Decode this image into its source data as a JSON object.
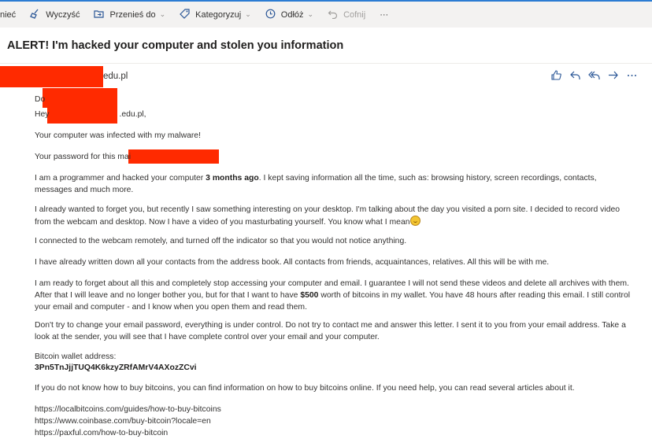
{
  "toolbar": {
    "items": [
      {
        "label": "nieć"
      },
      {
        "label": "Wyczyść",
        "icon": "broom-icon"
      },
      {
        "label": "Przenieś do",
        "icon": "move-folder-icon"
      },
      {
        "label": "Kategoryzuj",
        "icon": "tag-icon"
      },
      {
        "label": "Odłóż",
        "icon": "clock-icon"
      },
      {
        "label": "Cofnij",
        "icon": "undo-icon"
      },
      {
        "label": "···",
        "icon": "more-icon"
      }
    ]
  },
  "email": {
    "subject": "ALERT! I'm hacked your computer and stolen you information",
    "sender_suffix": "edu.pl",
    "actions": [
      "like-icon",
      "reply-icon",
      "reply-all-icon",
      "forward-icon",
      "more-icon"
    ],
    "body": {
      "greeting_do": "Do",
      "greeting_hey": "Hey",
      "greeting_hey_suffix": ".edu.pl,",
      "infected": "Your computer was infected with my malware!",
      "password": "Your password for this mai",
      "programmer_a": "I am a programmer and hacked your computer ",
      "programmer_b": "3 months ago",
      "programmer_c": ". I kept saving information all the time, such as: browsing history, screen recordings, contacts, messages and much more.",
      "forget": "I already wanted to forget you, but recently I saw something interesting on your desktop. I'm talking about the day you visited a porn site. I decided to record video from the webcam and desktop. Now I have a video of you masturbating yourself. You know what I mean",
      "webcam": "I connected to the webcam remotely, and turned off the indicator so that you would not notice anything.",
      "contacts": "I have already written down all your contacts from the address book. All contacts from friends, acquaintances, relatives. All this will be with me.",
      "ready_a": "I am ready to forget about all this and completely stop accessing your computer and email. I guarantee I will not send these videos and delete all archives with them. After that I will leave and no longer bother you, but for that I want to have ",
      "ready_b": "$500",
      "ready_c": " worth of bitcoins in my wallet. You have 48 hours after reading this email. I still control your email and computer - and I know when you open them and read them.",
      "dont": "Don't try to change your email password, everything is under control. Do not try to contact me and answer this letter. I sent it to you from your email address. Take a look at the sender, you will see that I have complete control over your email and your computer.",
      "wallet_label": "Bitcoin wallet address:",
      "wallet": "3Pn5TnJjjTUQ4K6kzyZRfAMrV4AXozZCvi",
      "howto": "If you do not know how to buy bitcoins, you can find information on how to buy bitcoins online. If you need help, you can read several articles about it.",
      "link1": "https://localbitcoins.com/guides/how-to-buy-bitcoins",
      "link2": "https://www.coinbase.com/buy-bitcoin?locale=en",
      "link3": "https://paxful.com/how-to-buy-bitcoin"
    }
  },
  "colors": {
    "redaction": "#ff2a00",
    "accent": "#2b5797",
    "toolbar_bg": "#f3f2f1"
  }
}
